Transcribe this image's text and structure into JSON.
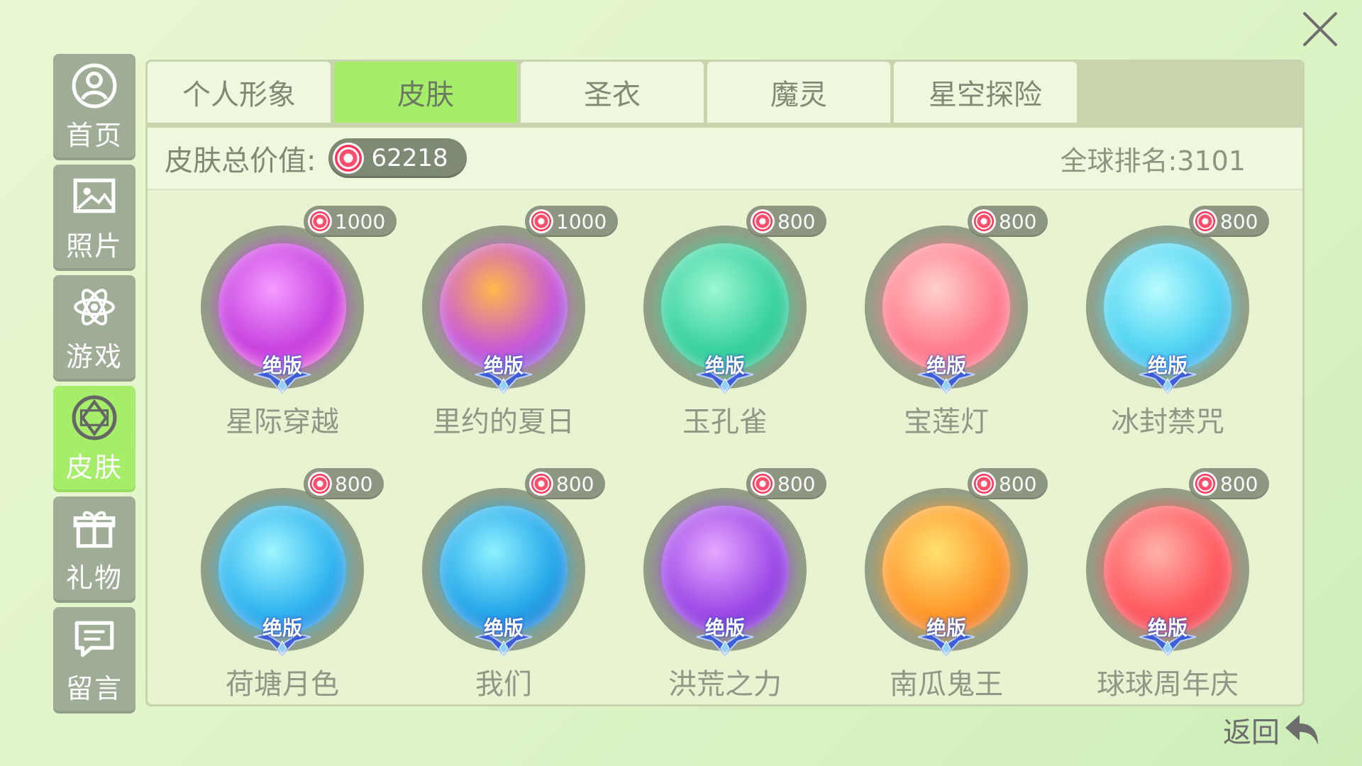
{
  "sidebar": {
    "items": [
      {
        "label": "首页",
        "icon": "home-user-icon",
        "active": false
      },
      {
        "label": "照片",
        "icon": "photo-icon",
        "active": false
      },
      {
        "label": "游戏",
        "icon": "atom-game-icon",
        "active": false
      },
      {
        "label": "皮肤",
        "icon": "skin-diamond-icon",
        "active": true
      },
      {
        "label": "礼物",
        "icon": "gift-icon",
        "active": false
      },
      {
        "label": "留言",
        "icon": "message-icon",
        "active": false
      }
    ]
  },
  "tabs": [
    {
      "label": "个人形象",
      "active": false
    },
    {
      "label": "皮肤",
      "active": true
    },
    {
      "label": "圣衣",
      "active": false
    },
    {
      "label": "魔灵",
      "active": false
    },
    {
      "label": "星空探险",
      "active": false
    }
  ],
  "summary": {
    "label": "皮肤总价值:",
    "total": "62218",
    "rank": "全球排名:3101"
  },
  "skins": [
    {
      "name": "星际穿越",
      "price": "1000",
      "badge": "绝版",
      "colors": [
        "#f59cff",
        "#c743e0",
        "#ff79d6"
      ]
    },
    {
      "name": "里约的夏日",
      "price": "1000",
      "badge": "绝版",
      "colors": [
        "#ffb84a",
        "#c95ad6",
        "#6a63e6"
      ]
    },
    {
      "name": "玉孔雀",
      "price": "800",
      "badge": "绝版",
      "colors": [
        "#9cf7d3",
        "#3bd29f",
        "#2ab889"
      ]
    },
    {
      "name": "宝莲灯",
      "price": "800",
      "badge": "绝版",
      "colors": [
        "#ffd0c9",
        "#ff7f8f",
        "#ff6f84"
      ]
    },
    {
      "name": "冰封禁咒",
      "price": "800",
      "badge": "绝版",
      "colors": [
        "#b8fbff",
        "#53d5f2",
        "#2a96e6"
      ]
    },
    {
      "name": "荷塘月色",
      "price": "800",
      "badge": "绝版",
      "colors": [
        "#9ff5ff",
        "#32b6ef",
        "#1f72d9"
      ]
    },
    {
      "name": "我们",
      "price": "800",
      "badge": "绝版",
      "colors": [
        "#8ef1ff",
        "#27a8ea",
        "#1c63c9"
      ]
    },
    {
      "name": "洪荒之力",
      "price": "800",
      "badge": "绝版",
      "colors": [
        "#e6a8ff",
        "#9f4be7",
        "#6d2bc5"
      ]
    },
    {
      "name": "南瓜鬼王",
      "price": "800",
      "badge": "绝版",
      "colors": [
        "#ffe171",
        "#ff9b2f",
        "#e0621d"
      ]
    },
    {
      "name": "球球周年庆",
      "price": "800",
      "badge": "绝版",
      "colors": [
        "#ffb2a8",
        "#ff5b61",
        "#e53b4a"
      ]
    }
  ],
  "back_label": "返回",
  "close_icon": "close-icon"
}
